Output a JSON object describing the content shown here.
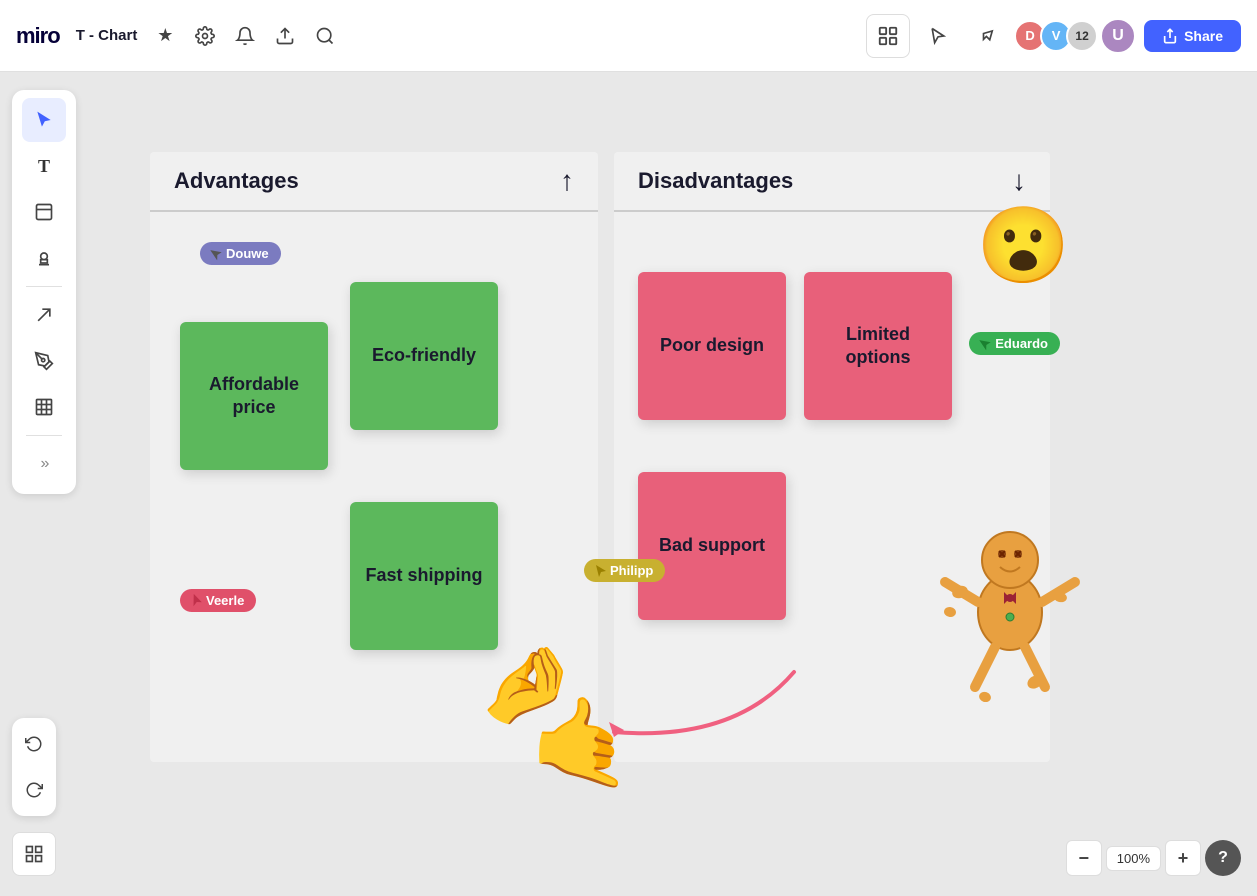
{
  "topbar": {
    "logo": "miro",
    "board_title": "T - Chart",
    "star_icon": "★",
    "settings_icon": "⚙",
    "bell_icon": "🔔",
    "share_icon": "↑",
    "search_icon": "🔍",
    "apps_icon": "⊞",
    "share_label": "Share",
    "zoom_out_label": "−",
    "zoom_in_label": "+",
    "zoom_level": "100%",
    "help_label": "?",
    "collaborator_count": "12"
  },
  "toolbar": {
    "tools": [
      {
        "name": "cursor",
        "icon": "▲",
        "label": "Select"
      },
      {
        "name": "text",
        "icon": "T",
        "label": "Text"
      },
      {
        "name": "sticky",
        "icon": "▭",
        "label": "Sticky note"
      },
      {
        "name": "connect",
        "icon": "⊕",
        "label": "Connect"
      },
      {
        "name": "arrow",
        "icon": "/",
        "label": "Arrow"
      },
      {
        "name": "pen",
        "icon": "✏",
        "label": "Pen"
      },
      {
        "name": "frame",
        "icon": "⊞",
        "label": "Frame"
      },
      {
        "name": "more",
        "icon": "»",
        "label": "More"
      }
    ],
    "undo_icon": "↩",
    "redo_icon": "↪"
  },
  "chart": {
    "title": "T-Chart",
    "advantages_title": "Advantages",
    "advantages_arrow": "↑",
    "disadvantages_title": "Disadvantages",
    "disadvantages_arrow": "↓",
    "advantage_notes": [
      {
        "id": "affordable",
        "text": "Affordable price",
        "color": "green"
      },
      {
        "id": "ecofriendly",
        "text": "Eco-friendly",
        "color": "green"
      },
      {
        "id": "fastshipping",
        "text": "Fast shipping",
        "color": "green"
      }
    ],
    "disadvantage_notes": [
      {
        "id": "poordesign",
        "text": "Poor design",
        "color": "pink"
      },
      {
        "id": "limitedoptions",
        "text": "Limited options",
        "color": "pink"
      },
      {
        "id": "badsupport",
        "text": "Bad support",
        "color": "pink"
      }
    ],
    "cursors": [
      {
        "name": "Douwe",
        "color": "#9b9ecf",
        "bg": "#8888cc"
      },
      {
        "name": "Veerle",
        "color": "#f06080",
        "bg": "#e0506a"
      },
      {
        "name": "Philipp",
        "color": "#e0c840",
        "bg": "#c8b030"
      },
      {
        "name": "Eduardo",
        "color": "#4ec86a",
        "bg": "#38b054"
      }
    ]
  },
  "bottom_toolbar": {
    "layers_icon": "▦"
  }
}
